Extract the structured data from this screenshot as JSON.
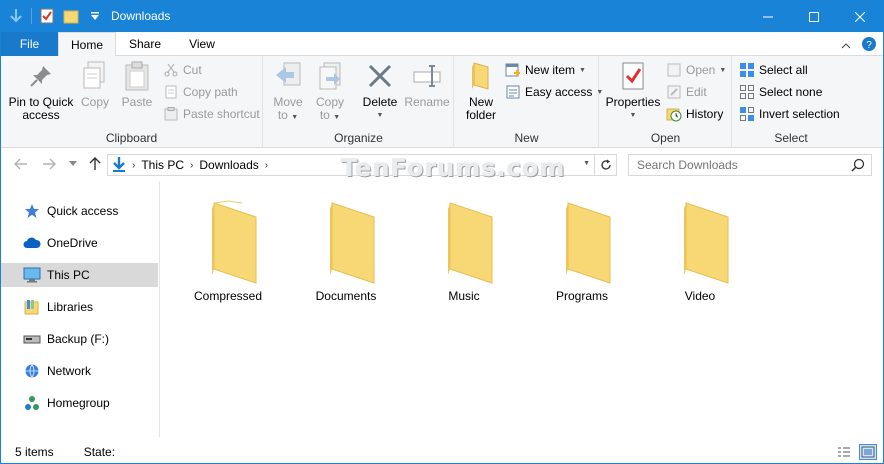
{
  "window": {
    "title": "Downloads"
  },
  "tabs": {
    "file": "File",
    "home": "Home",
    "share": "Share",
    "view": "View"
  },
  "ribbon": {
    "clipboard": {
      "label": "Clipboard",
      "pin": [
        "Pin to Quick",
        "access"
      ],
      "copy": "Copy",
      "paste": "Paste",
      "cut": "Cut",
      "copy_path": "Copy path",
      "paste_shortcut": "Paste shortcut"
    },
    "organize": {
      "label": "Organize",
      "move_to": [
        "Move",
        "to"
      ],
      "copy_to": [
        "Copy",
        "to"
      ],
      "delete": "Delete",
      "rename": "Rename"
    },
    "new": {
      "label": "New",
      "new_folder": [
        "New",
        "folder"
      ],
      "new_item": "New item",
      "easy_access": "Easy access"
    },
    "open": {
      "label": "Open",
      "properties": "Properties",
      "open": "Open",
      "edit": "Edit",
      "history": "History"
    },
    "select": {
      "label": "Select",
      "select_all": "Select all",
      "select_none": "Select none",
      "invert_selection": "Invert selection"
    }
  },
  "address": {
    "parts": [
      "This PC",
      "Downloads"
    ],
    "search_placeholder": "Search Downloads",
    "watermark": "TenForums.com"
  },
  "nav_pane": {
    "items": [
      {
        "label": "Quick access",
        "icon": "star-icon"
      },
      {
        "label": "OneDrive",
        "icon": "cloud-icon"
      },
      {
        "label": "This PC",
        "icon": "computer-icon",
        "selected": true
      },
      {
        "label": "Libraries",
        "icon": "libraries-icon"
      },
      {
        "label": "Backup (F:)",
        "icon": "drive-icon"
      },
      {
        "label": "Network",
        "icon": "network-icon"
      },
      {
        "label": "Homegroup",
        "icon": "homegroup-icon"
      }
    ]
  },
  "folders": [
    {
      "name": "Compressed"
    },
    {
      "name": "Documents"
    },
    {
      "name": "Music"
    },
    {
      "name": "Programs"
    },
    {
      "name": "Video"
    }
  ],
  "status": {
    "count": "5 items",
    "state": "State:"
  },
  "colors": {
    "titlebar": "#1883d7",
    "file_tab": "#1979ca",
    "folder": "#f8d775",
    "selected_nav": "#d9d9d9"
  }
}
